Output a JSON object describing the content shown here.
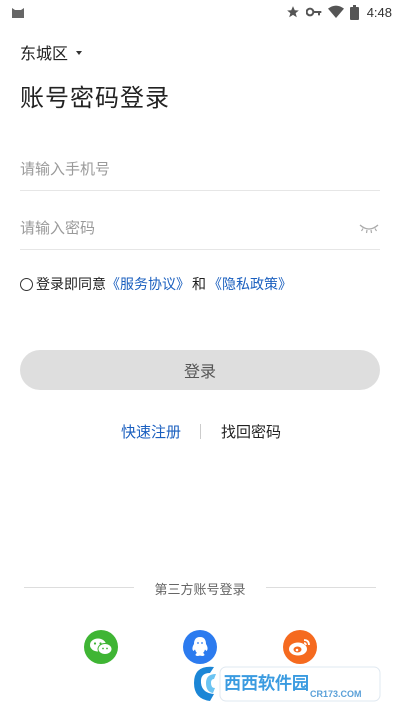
{
  "status_bar": {
    "time": "4:48",
    "icons": [
      "app-notification-icon",
      "star-icon",
      "key-icon",
      "wifi-icon",
      "battery-icon"
    ]
  },
  "city_selector": {
    "label": "东城区",
    "icon": "caret-down-icon"
  },
  "title": "账号密码登录",
  "phone_field": {
    "placeholder": "请输入手机号",
    "value": ""
  },
  "password_field": {
    "placeholder": "请输入密码",
    "value": "",
    "toggle_icon": "eye-closed-icon"
  },
  "agreement": {
    "checked": false,
    "prefix": "登录即同意",
    "service_link": "《服务协议》",
    "and": "和",
    "privacy_link": "《隐私政策》"
  },
  "login_button": {
    "label": "登录"
  },
  "links": {
    "register": "快速注册",
    "forgot": "找回密码"
  },
  "third_party": {
    "label": "第三方账号登录",
    "providers": [
      {
        "name": "wechat",
        "icon": "wechat-icon",
        "color": "#3fb534"
      },
      {
        "name": "qq",
        "icon": "qq-icon",
        "color": "#2c7bef"
      },
      {
        "name": "weibo",
        "icon": "weibo-icon",
        "color": "#f56a1f"
      }
    ]
  },
  "watermark": {
    "text": "西西软件园",
    "site": "CR173.COM"
  },
  "colors": {
    "link": "#1a5fbf",
    "button_disabled": "#dedede"
  }
}
